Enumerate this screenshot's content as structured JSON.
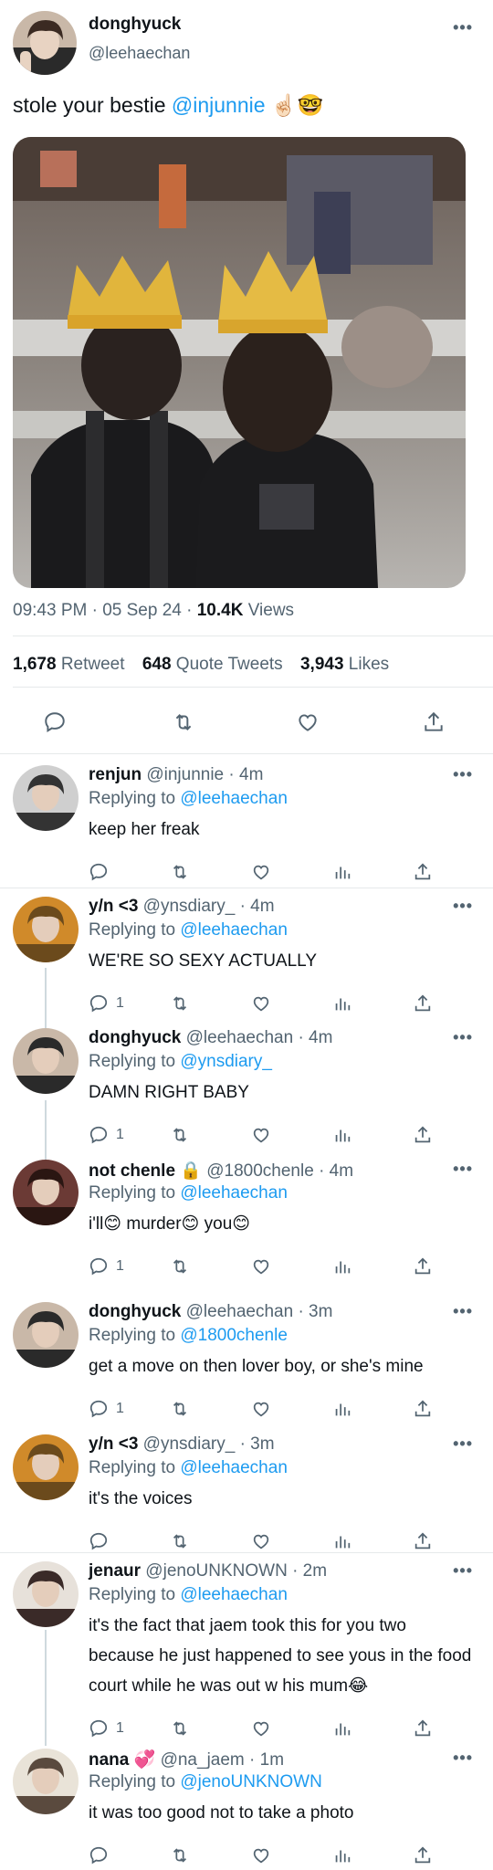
{
  "main_tweet": {
    "display_name": "donghyuck",
    "handle": "@leehaechan",
    "text_prefix": "stole your bestie ",
    "mention": "@injunnie",
    "emoji": "☝🏻🤓",
    "time": "09:43 PM · 05 Sep 24 · ",
    "views_count": "10.4K",
    "views_label": " Views",
    "retweets_count": "1,678",
    "retweets_label": " Retweet",
    "quotes_count": "648",
    "quotes_label": " Quote Tweets",
    "likes_count": "3,943",
    "likes_label": " Likes"
  },
  "replies": [
    {
      "name": "renjun",
      "handle": "@injunnie",
      "time": "· 4m",
      "replying_label": "Replying to ",
      "replying_to": "@leehaechan",
      "text": "keep her freak",
      "reply_count": ""
    },
    {
      "name": "y/n <3",
      "handle": "@ynsdiary_",
      "time": "· 4m",
      "replying_label": "Replying to ",
      "replying_to": "@leehaechan",
      "text": "WE'RE SO SEXY ACTUALLY",
      "reply_count": "1"
    },
    {
      "name": "donghyuck",
      "handle": "@leehaechan",
      "time": "· 4m",
      "replying_label": "Replying to ",
      "replying_to": "@ynsdiary_",
      "text": "DAMN RIGHT BABY",
      "reply_count": "1"
    },
    {
      "name": "not chenle",
      "name_badge": "🔒",
      "handle": "@1800chenle",
      "time": "· 4m",
      "replying_label": "Replying to ",
      "replying_to": "@leehaechan",
      "text": "i'll😊 murder😊 you😊",
      "reply_count": "1"
    },
    {
      "name": "donghyuck",
      "handle": "@leehaechan",
      "time": "· 3m",
      "replying_label": "Replying to ",
      "replying_to": "@1800chenle",
      "text": "get a move on then lover boy, or she's mine",
      "reply_count": "1"
    },
    {
      "name": "y/n <3",
      "handle": "@ynsdiary_",
      "time": "· 3m",
      "replying_label": "Replying to ",
      "replying_to": "@leehaechan",
      "text": "it's the voices",
      "reply_count": ""
    },
    {
      "name": "jenaur",
      "handle": "@jenoUNKNOWN",
      "time": "· 2m",
      "replying_label": "Replying to ",
      "replying_to": "@leehaechan",
      "text": "it's the fact that jaem took this for you two because he just happened to see yous in the food court while he was out w his mum😂",
      "reply_count": "1"
    },
    {
      "name": "nana",
      "name_badge": "💞",
      "handle": "@na_jaem",
      "time": "· 1m",
      "replying_label": "Replying to ",
      "replying_to": "@jenoUNKNOWN",
      "text": "it was too good not to take a photo",
      "reply_count": ""
    }
  ],
  "colors": {
    "link": "#1d9bf0",
    "muted": "#536471",
    "text": "#0f1419",
    "divider": "#e6e9ea"
  },
  "icons": [
    "more-icon",
    "reply-icon",
    "retweet-icon",
    "like-icon",
    "views-icon",
    "share-icon"
  ]
}
